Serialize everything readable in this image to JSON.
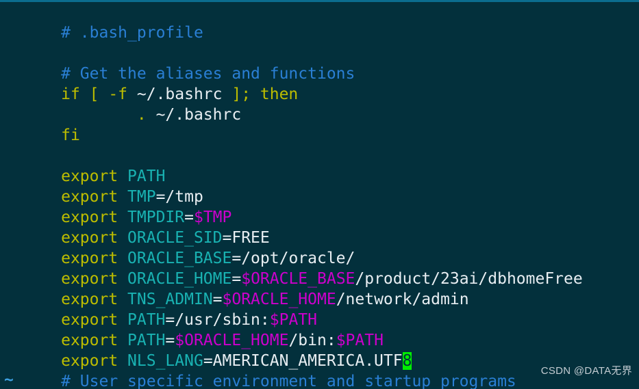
{
  "window": {
    "title": ".bash_profile",
    "editor": "vim",
    "background_color": "#03303c",
    "top_edge_color": "#0b6d8f"
  },
  "colors": {
    "comment": "#2a7fd4",
    "keyword": "#bdbd00",
    "identifier": "#19b2b2",
    "variable": "#cc00cc",
    "text": "#e8eef2",
    "cursor_background": "#00ee00",
    "cursor_foreground": "#03303c",
    "tilde": "#3d9fe0",
    "watermark": "#c3ccd2"
  },
  "buffer": {
    "lines": [
      {
        "id": "l1",
        "text": "# .bash_profile"
      },
      {
        "id": "l2",
        "text": ""
      },
      {
        "id": "l3",
        "text": "# Get the aliases and functions"
      },
      {
        "id": "l4",
        "text": "if [ -f ~/.bashrc ]; then"
      },
      {
        "id": "l5",
        "text": "        . ~/.bashrc"
      },
      {
        "id": "l6",
        "text": "fi"
      },
      {
        "id": "l7",
        "text": ""
      },
      {
        "id": "l8",
        "text": "export PATH"
      },
      {
        "id": "l9",
        "text": "export TMP=/tmp"
      },
      {
        "id": "l10",
        "text": "export TMPDIR=$TMP"
      },
      {
        "id": "l11",
        "text": "export ORACLE_SID=FREE"
      },
      {
        "id": "l12",
        "text": "export ORACLE_BASE=/opt/oracle/"
      },
      {
        "id": "l13",
        "text": "export ORACLE_HOME=$ORACLE_BASE/product/23ai/dbhomeFree"
      },
      {
        "id": "l14",
        "text": "export TNS_ADMIN=$ORACLE_HOME/network/admin"
      },
      {
        "id": "l15",
        "text": "export PATH=/usr/sbin:$PATH"
      },
      {
        "id": "l16",
        "text": "export PATH=$ORACLE_HOME/bin:$PATH"
      },
      {
        "id": "l17",
        "text": "export NLS_LANG=AMERICAN_AMERICA.UTF8"
      },
      {
        "id": "l18",
        "text": "# User specific environment and startup programs"
      },
      {
        "id": "l19",
        "text": "~"
      }
    ],
    "tokens": {
      "l1": {
        "comment": "# .bash_profile"
      },
      "l3": {
        "comment": "# Get the aliases and functions"
      },
      "l4": {
        "kw_if": "if [ -f ",
        "text": "~/.bashrc",
        "kw_then": " ]; then"
      },
      "l5": {
        "indent": "        ",
        "kw_dot": ".",
        "text": " ~/.bashrc"
      },
      "l6": {
        "kw_fi": "fi"
      },
      "l8": {
        "kw": "export ",
        "ident": "PATH"
      },
      "l9": {
        "kw": "export ",
        "ident": "TMP",
        "text": "=/tmp"
      },
      "l10": {
        "kw": "export ",
        "ident": "TMPDIR",
        "eq": "=",
        "var": "$TMP"
      },
      "l11": {
        "kw": "export ",
        "ident": "ORACLE_SID",
        "text": "=FREE"
      },
      "l12": {
        "kw": "export ",
        "ident": "ORACLE_BASE",
        "text": "=/opt/oracle/"
      },
      "l13": {
        "kw": "export ",
        "ident": "ORACLE_HOME",
        "eq": "=",
        "var": "$ORACLE_BASE",
        "text": "/product/23ai/dbhomeFree"
      },
      "l14": {
        "kw": "export ",
        "ident": "TNS_ADMIN",
        "eq": "=",
        "var": "$ORACLE_HOME",
        "text": "/network/admin"
      },
      "l15": {
        "kw": "export ",
        "ident": "PATH",
        "text": "=/usr/sbin:",
        "var": "$PATH"
      },
      "l16": {
        "kw": "export ",
        "ident": "PATH",
        "eq": "=",
        "var": "$ORACLE_HOME",
        "text": "/bin:",
        "var2": "$PATH"
      },
      "l17": {
        "kw": "export ",
        "ident": "NLS_LANG",
        "text": "=AMERICAN_AMERICA.UTF",
        "cursor": "8"
      },
      "l18": {
        "comment": "# User specific environment and startup programs"
      },
      "l19": {
        "tilde": "~"
      }
    }
  },
  "cursor": {
    "line": 17,
    "character": "8",
    "shape": "block"
  },
  "watermark": {
    "text": "CSDN @DATA无界"
  }
}
